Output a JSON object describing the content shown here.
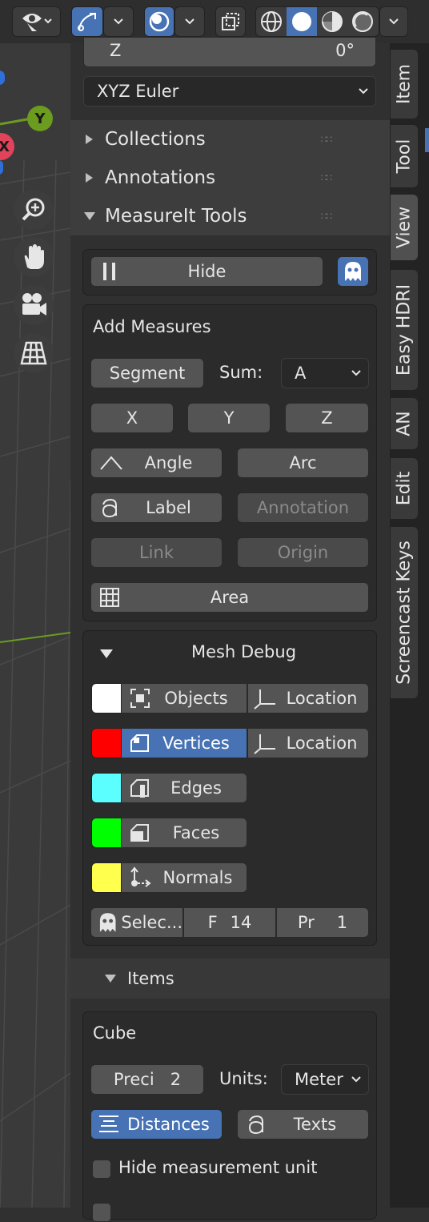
{
  "colors": {
    "accent": "#4772b3",
    "axis_y": "#6c9c1f",
    "axis_x": "#e0435a",
    "white_swatch": "#ffffff",
    "red_swatch": "#ff0000",
    "cyan_swatch": "#5cffff",
    "green_swatch": "#00ff00",
    "yellow_swatch": "#ffff4d"
  },
  "gizmo": {
    "y_label": "Y",
    "x_label": "X"
  },
  "rotation": {
    "z_label": "Z",
    "z_value": "0°",
    "mode": "XYZ Euler"
  },
  "panels": {
    "collections": "Collections",
    "annotations": "Annotations",
    "measureit": "MeasureIt Tools"
  },
  "hide_button": "Hide",
  "add_measures": {
    "title": "Add Measures",
    "segment": "Segment",
    "sum_label": "Sum:",
    "sum_value": "A",
    "x": "X",
    "y": "Y",
    "z": "Z",
    "angle": "Angle",
    "arc": "Arc",
    "label": "Label",
    "annotation": "Annotation",
    "link": "Link",
    "origin": "Origin",
    "area": "Area"
  },
  "mesh_debug": {
    "title": "Mesh Debug",
    "objects": "Objects",
    "location1": "Location",
    "vertices": "Vertices",
    "location2": "Location",
    "edges": "Edges",
    "faces": "Faces",
    "normals": "Normals",
    "selec": "Selec...",
    "f_label": "F",
    "f_value": "14",
    "pr_label": "Pr",
    "pr_value": "1"
  },
  "items": {
    "title": "Items",
    "object_name": "Cube",
    "preci_label": "Preci",
    "preci_value": "2",
    "units_label": "Units:",
    "units_value": "Meter",
    "distances": "Distances",
    "texts": "Texts",
    "hide_unit": "Hide measurement unit"
  },
  "sidebar_tabs": [
    "Item",
    "Tool",
    "View",
    "Easy HDRI",
    "AN",
    "Edit",
    "Screencast Keys"
  ]
}
